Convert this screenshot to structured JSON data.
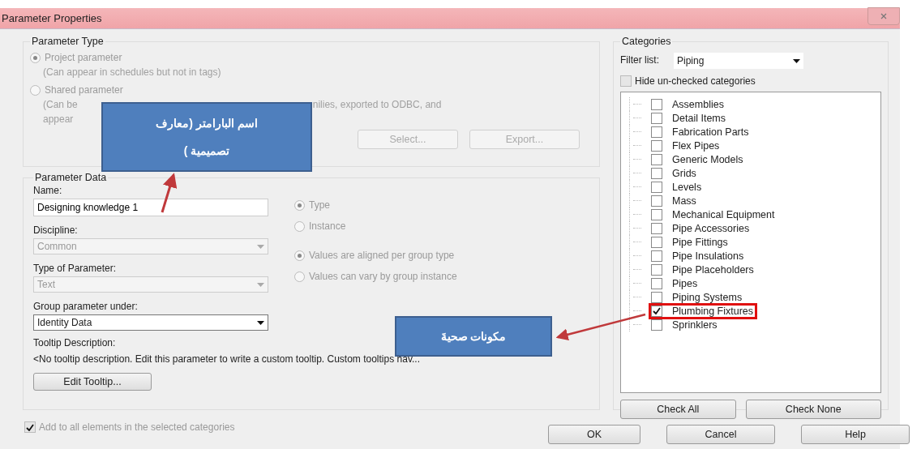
{
  "window": {
    "title": "Parameter Properties"
  },
  "parameter_type": {
    "title": "Parameter Type",
    "disabled": true,
    "options": [
      {
        "label": "Project parameter",
        "selected": true,
        "note_lines": [
          [
            "(Can appear in schedules but not in tags)"
          ]
        ]
      },
      {
        "label": "Shared parameter",
        "selected": false,
        "note_lines": [
          [
            "(Can be",
            "nilies, exported to ODBC, and"
          ],
          [
            "appear"
          ]
        ]
      }
    ],
    "buttons": [
      "Select...",
      "Export..."
    ]
  },
  "parameter_data": {
    "title": "Parameter Data",
    "name_label": "Name:",
    "name_value": "Designing knowledge 1",
    "fields": [
      {
        "label": "Discipline:",
        "value": "Common",
        "disabled": true
      },
      {
        "label": "Type of Parameter:",
        "value": "Text",
        "disabled": true
      },
      {
        "label": "Group parameter under:",
        "value": "Identity Data",
        "disabled": false
      }
    ],
    "radio_groups": [
      [
        {
          "label": "Type",
          "selected": true,
          "disabled": true
        },
        {
          "label": "Instance",
          "selected": false,
          "disabled": true
        }
      ],
      [
        {
          "label": "Values are aligned per group type",
          "selected": true,
          "disabled": true
        },
        {
          "label": "Values can vary by group instance",
          "selected": false,
          "disabled": true
        }
      ]
    ],
    "tooltip_label": "Tooltip Description:",
    "tooltip_text": "<No tooltip description. Edit this parameter to write a custom tooltip. Custom tooltips hav...",
    "edit_button": "Edit Tooltip..."
  },
  "add_to_all": {
    "label": "Add to all elements in the selected categories",
    "checked": true,
    "disabled": true
  },
  "categories": {
    "title": "Categories",
    "filter_label": "Filter list:",
    "filter_value": "Piping",
    "hide_unchecked": {
      "label": "Hide un-checked categories",
      "checked": false
    },
    "items": [
      {
        "label": "Assemblies",
        "checked": false,
        "highlighted": false
      },
      {
        "label": "Detail Items",
        "checked": false,
        "highlighted": false
      },
      {
        "label": "Fabrication Parts",
        "checked": false,
        "highlighted": false
      },
      {
        "label": "Flex Pipes",
        "checked": false,
        "highlighted": false
      },
      {
        "label": "Generic Models",
        "checked": false,
        "highlighted": false
      },
      {
        "label": "Grids",
        "checked": false,
        "highlighted": false
      },
      {
        "label": "Levels",
        "checked": false,
        "highlighted": false
      },
      {
        "label": "Mass",
        "checked": false,
        "highlighted": false
      },
      {
        "label": "Mechanical Equipment",
        "checked": false,
        "highlighted": false
      },
      {
        "label": "Pipe Accessories",
        "checked": false,
        "highlighted": false
      },
      {
        "label": "Pipe Fittings",
        "checked": false,
        "highlighted": false
      },
      {
        "label": "Pipe Insulations",
        "checked": false,
        "highlighted": false
      },
      {
        "label": "Pipe Placeholders",
        "checked": false,
        "highlighted": false
      },
      {
        "label": "Pipes",
        "checked": false,
        "highlighted": false
      },
      {
        "label": "Piping Systems",
        "checked": false,
        "highlighted": false
      },
      {
        "label": "Plumbing Fixtures",
        "checked": true,
        "highlighted": true
      },
      {
        "label": "Sprinklers",
        "checked": false,
        "highlighted": false
      }
    ],
    "buttons": [
      "Check All",
      "Check None"
    ]
  },
  "footer_buttons": [
    "OK",
    "Cancel",
    "Help"
  ],
  "callouts": [
    {
      "text": "اسم البارامتر (معارف تصميمية )"
    },
    {
      "text": "مكونات صحيةَ"
    }
  ]
}
